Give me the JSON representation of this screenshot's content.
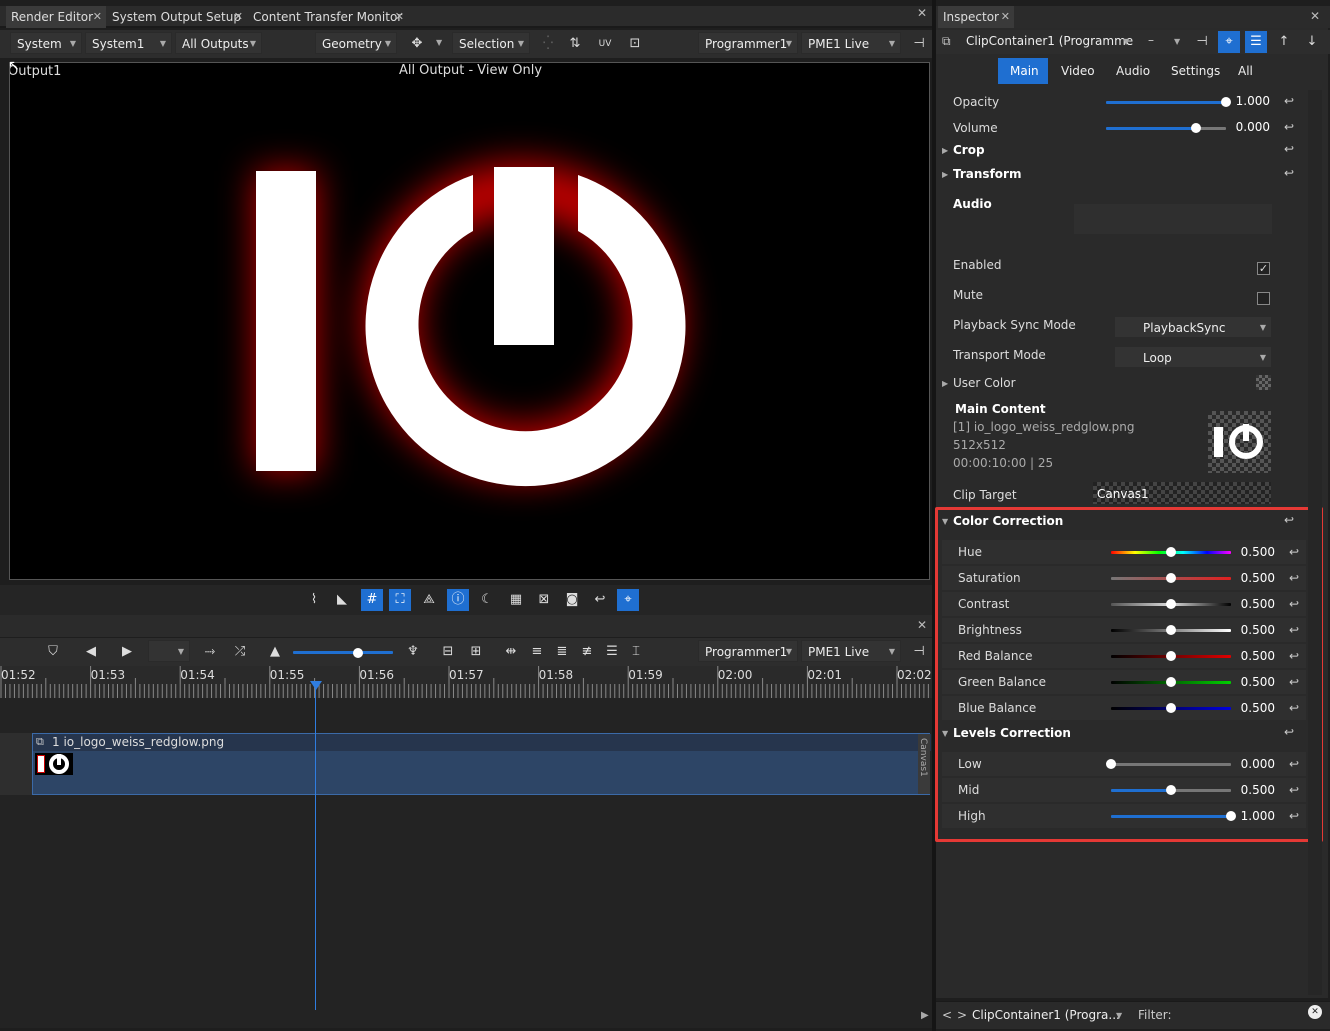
{
  "tabs": [
    {
      "label": "Render Editor"
    },
    {
      "label": "System Output Setup"
    },
    {
      "label": "Content Transfer Monitor"
    }
  ],
  "inspector_tab": "Inspector",
  "toolbar": {
    "system": "System",
    "system1": "System1",
    "outputs": "All Outputs",
    "geometry": "Geometry",
    "selection": "Selection",
    "programmer": "Programmer1",
    "live": "PME1 Live"
  },
  "viewport": {
    "output_label": "Output1",
    "view_label": "All Output - View Only"
  },
  "inspector": {
    "header_title": "ClipContainer1 (Programme",
    "header_dash": "–",
    "subtabs": [
      "Main",
      "Video",
      "Audio",
      "Settings",
      "All"
    ],
    "opacity": {
      "label": "Opacity",
      "value": "1.000",
      "level": 1.0
    },
    "volume": {
      "label": "Volume",
      "value": "0.000",
      "level": 0.75
    },
    "crop": "Crop",
    "transform": "Transform",
    "audio": "Audio",
    "enabled": "Enabled",
    "mute": "Mute",
    "playback_sync_label": "Playback Sync Mode",
    "playback_sync_value": "PlaybackSync",
    "transport_label": "Transport Mode",
    "transport_value": "Loop",
    "user_color": "User Color",
    "main_content": "Main Content",
    "file_name": "[1] io_logo_weiss_redglow.png",
    "file_size": "512x512",
    "file_time": "00:00:10:00 | 25",
    "clip_target_label": "Clip Target",
    "clip_target_value": "Canvas1",
    "color_correction": "Color Correction",
    "cc": [
      {
        "label": "Hue",
        "value": "0.500",
        "level": 0.5
      },
      {
        "label": "Saturation",
        "value": "0.500",
        "level": 0.5
      },
      {
        "label": "Contrast",
        "value": "0.500",
        "level": 0.5
      },
      {
        "label": "Brightness",
        "value": "0.500",
        "level": 0.5
      },
      {
        "label": "Red Balance",
        "value": "0.500",
        "level": 0.5
      },
      {
        "label": "Green Balance",
        "value": "0.500",
        "level": 0.5
      },
      {
        "label": "Blue Balance",
        "value": "0.500",
        "level": 0.5
      }
    ],
    "levels_correction": "Levels Correction",
    "levels": [
      {
        "label": "Low",
        "value": "0.000",
        "level": 0.0
      },
      {
        "label": "Mid",
        "value": "0.500",
        "level": 0.5
      },
      {
        "label": "High",
        "value": "1.000",
        "level": 1.0
      }
    ],
    "footer_path": "ClipContainer1 (Progra...",
    "footer_filter": "Filter:",
    "footer_prev": "<",
    "footer_next": ">"
  },
  "timeline": {
    "programmer": "Programmer1",
    "live": "PME1 Live",
    "ticks": [
      "01:52",
      "01:53",
      "01:54",
      "01:55",
      "01:56",
      "01:57",
      "01:58",
      "01:59",
      "02:00",
      "02:01",
      "02:02"
    ],
    "clip_label": "1 io_logo_weiss_redglow.png",
    "canvas_label": "Canvas1"
  },
  "colors": {
    "accent": "#1f6fd1",
    "highlight_border": "#e53935"
  }
}
